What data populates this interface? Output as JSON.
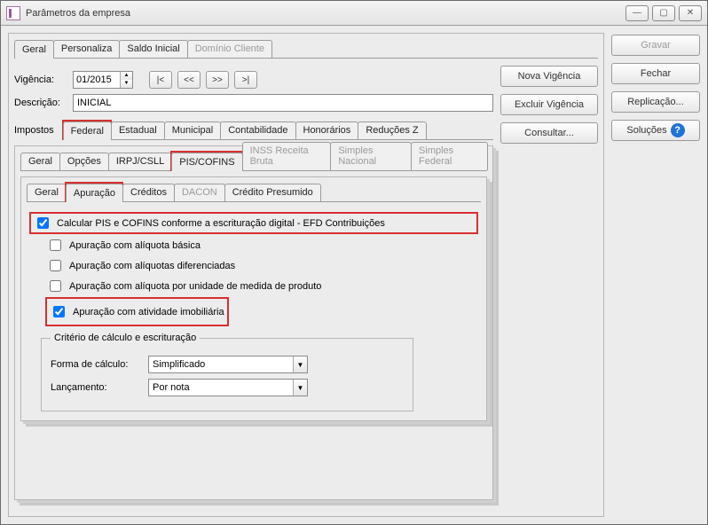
{
  "window": {
    "title": "Parâmetros da empresa"
  },
  "mainTabs": {
    "geral": "Geral",
    "personaliza": "Personaliza",
    "saldoInicial": "Saldo Inicial",
    "dominioCliente": "Domínio Cliente"
  },
  "vigencia": {
    "label": "Vigência:",
    "value": "01/2015"
  },
  "nav": {
    "first": "|<",
    "prev": "<<",
    "next": ">>",
    "last": ">|"
  },
  "descricao": {
    "label": "Descrição:",
    "value": "INICIAL"
  },
  "actionButtons": {
    "novaVigencia": "Nova Vigência",
    "excluirVigencia": "Excluir Vigência",
    "consultar": "Consultar..."
  },
  "sideButtons": {
    "gravar": "Gravar",
    "fechar": "Fechar",
    "replicacao": "Replicação...",
    "solucoes": "Soluções"
  },
  "impostos": {
    "label": "Impostos",
    "tabs": {
      "federal": "Federal",
      "estadual": "Estadual",
      "municipal": "Municipal",
      "contabilidade": "Contabilidade",
      "honorarios": "Honorários",
      "reducoesZ": "Reduções Z"
    }
  },
  "federalTabs": {
    "geral": "Geral",
    "opcoes": "Opções",
    "irpjCsll": "IRPJ/CSLL",
    "pisCofins": "PIS/COFINS",
    "inssReceitaBruta": "INSS Receita Bruta",
    "simplesNacional": "Simples Nacional",
    "simplesFederal": "Simples Federal"
  },
  "pisCofinsTabs": {
    "geral": "Geral",
    "apuracao": "Apuração",
    "creditos": "Créditos",
    "dacon": "DACON",
    "creditoPresumido": "Crédito Presumido"
  },
  "checks": {
    "calcEfd": "Calcular PIS e COFINS conforme a escrituração digital - EFD Contribuições",
    "aliqBasica": "Apuração com alíquota básica",
    "aliqDif": "Apuração com alíquotas diferenciadas",
    "aliqUnidade": "Apuração com alíquota por unidade de medida de produto",
    "ativImob": "Apuração com atividade imobiliária"
  },
  "criterio": {
    "legend": "Critério de cálculo e escrituração",
    "formaLabel": "Forma de cálculo:",
    "formaValue": "Simplificado",
    "lancLabel": "Lançamento:",
    "lancValue": "Por nota"
  }
}
